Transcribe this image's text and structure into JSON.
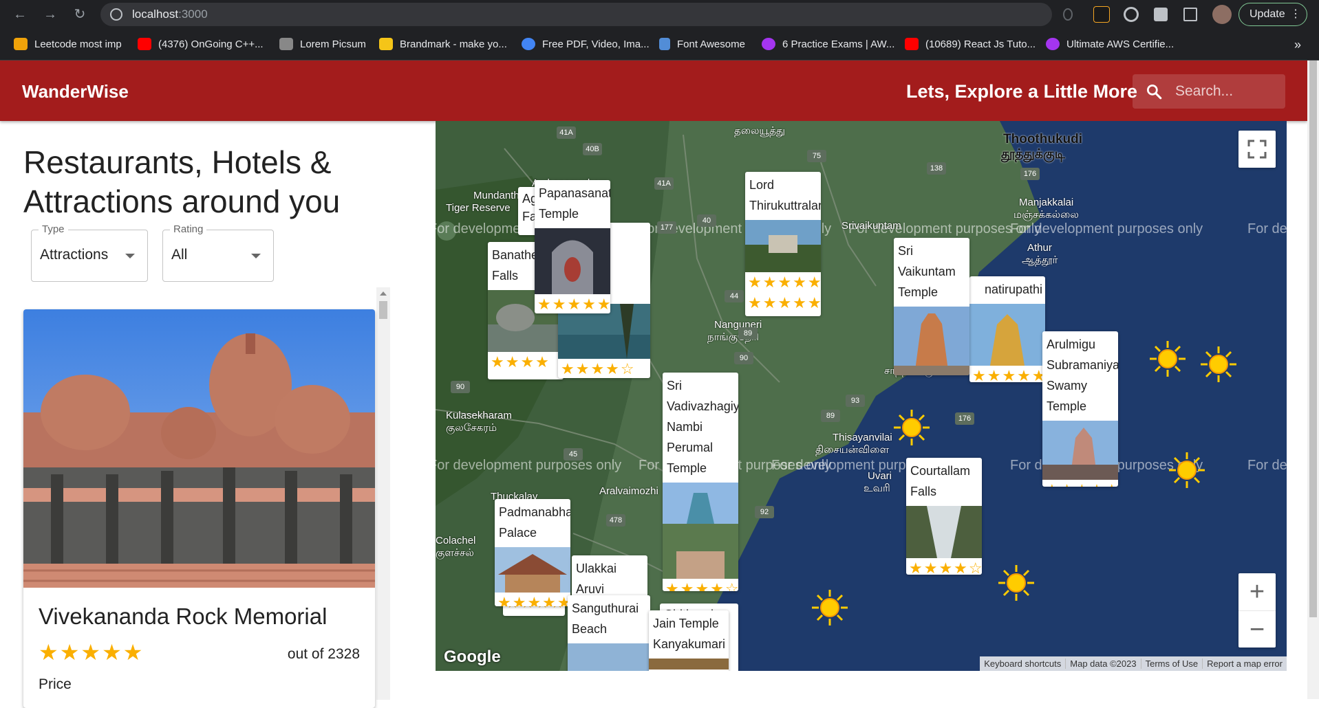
{
  "browser": {
    "url_host": "localhost",
    "url_port": ":3000",
    "update_label": "Update",
    "bookmarks": [
      {
        "label": "Leetcode most imp",
        "color": "#f0a30a"
      },
      {
        "label": "(4376) OnGoing C++...",
        "color": "#ff0000"
      },
      {
        "label": "Lorem Picsum",
        "color": "#888888"
      },
      {
        "label": "Brandmark - make yo...",
        "color": "#f5c518"
      },
      {
        "label": "Free PDF, Video, Ima...",
        "color": "#4285f4"
      },
      {
        "label": "Font Awesome",
        "color": "#528dd7"
      },
      {
        "label": "6 Practice Exams | AW...",
        "color": "#a435f0"
      },
      {
        "label": "(10689) React Js Tuto...",
        "color": "#ff0000"
      },
      {
        "label": "Ultimate AWS Certifie...",
        "color": "#a435f0"
      }
    ],
    "more_bookmarks": "»"
  },
  "header": {
    "brand": "WanderWise",
    "tagline": "Lets, Explore a Little More",
    "search_placeholder": "Search..."
  },
  "panel": {
    "title": "Restaurants, Hotels & Attractions around you",
    "type_label": "Type",
    "type_value": "Attractions",
    "rating_label": "Rating",
    "rating_value": "All"
  },
  "place": {
    "name": "Vivekananda Rock Memorial",
    "stars": "★★★★★",
    "rating": 5,
    "reviews_text": "out of 2328",
    "price_label": "Price"
  },
  "map": {
    "watermark": "For development purposes only",
    "labels": {
      "thoothukudi": "Thoothukudi",
      "thoothukudi_ta": "தூத்துக்குடி",
      "manjakkalai": "Manjakkalai",
      "manjakkalai_ta": "மஞ்சக்கல்லை",
      "srivaikuntam": "Srivaikuntam",
      "athur": "Athur",
      "athur_ta": "ஆத்தூர்",
      "mundanthurai": "Mundanthurai",
      "tiger_reserve": "Tiger Reserve",
      "ambasamudram": "Ambasamudram",
      "nanguneri": "Nanguneri",
      "nanguneri_ta": "நாங்குநேரி",
      "kulasekharam": "Kulasekharam",
      "kulasekharam_ta": "குலசேகரம்",
      "thisayanvilai": "Thisayanvilai",
      "thisayanvilai_ta": "திசையன்விளை",
      "uvari": "Uvari",
      "uvari_ta": "உவரி",
      "aralvaimozhi": "Aralvaimozhi",
      "thuckalay": "Thuckalay",
      "colachel": "Colachel",
      "colachel_ta": "குளச்சல்",
      "sathankulam_ta": "சாத்தான்குளம்",
      "tamil_top": "தலையூத்து",
      "kanyakumari_edge": "Kanyakumari"
    },
    "route_shields": [
      "41A",
      "40B",
      "75",
      "138",
      "176",
      "41A",
      "177",
      "40",
      "90",
      "44",
      "89",
      "90",
      "93",
      "45",
      "89",
      "176",
      "92",
      "478"
    ],
    "cards": [
      {
        "title": "Papanasanatha Temple",
        "stars": "★★★★★"
      },
      {
        "title": "Banatheertham Falls",
        "stars": "★★★★"
      },
      {
        "title": "",
        "stars": "★★★★☆"
      },
      {
        "title": "Lord Thirukuttralanathar",
        "stars": "★★★★★"
      },
      {
        "title": "Sri Vaikuntam Temple",
        "stars": "★★★★★"
      },
      {
        "title": "Thiruchendur Venkatachalapathi",
        "stars": "★★★★★"
      },
      {
        "title": "Arulmigu Subramaniya Swamy Temple",
        "stars": "★★★★★"
      },
      {
        "title": "Sri Vadivazhagiya Nambi Perumal Temple",
        "stars": "★★★★☆"
      },
      {
        "title": "Courtallam Falls",
        "stars": "★★★★☆"
      },
      {
        "title": "Padmanabhapuram Palace",
        "stars": "★★★★★"
      },
      {
        "title": "Ulakkai Aruvi",
        "stars": ""
      },
      {
        "title": "Sanguthurai Beach",
        "stars": ""
      },
      {
        "title": "Chitharal Hill",
        "stars": ""
      },
      {
        "title": "Jain Temple Kanyakumari",
        "stars": ""
      }
    ],
    "card_title_partials": {
      "thiruchendur": "natirupathi",
      "banatheertham_1": "Banathe",
      "banatheertham_2": "Falls",
      "padmanabha": "Padmanabhapur",
      "padmanabha_2": "Palace",
      "hidden_card_top": "Ag",
      "hidden_card_top_2": "Fa",
      "chitharal": "Chitharal Hill"
    },
    "google_logo": "Google",
    "attribution": [
      "Keyboard shortcuts",
      "Map data ©2023",
      "Terms of Use",
      "Report a map error"
    ],
    "zoom_in": "+",
    "zoom_out": "−"
  },
  "colors": {
    "appbar": "#a31c1c",
    "star": "#faaf00",
    "sea": "#1e3a6b",
    "land": "#4e6e4b"
  }
}
